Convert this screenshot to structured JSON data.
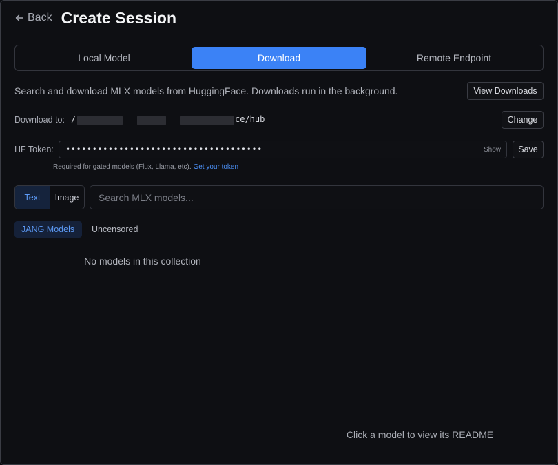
{
  "header": {
    "back_label": "Back",
    "title": "Create Session"
  },
  "mode_tabs": [
    {
      "label": "Local Model",
      "active": false
    },
    {
      "label": "Download",
      "active": true
    },
    {
      "label": "Remote Endpoint",
      "active": false
    }
  ],
  "description": "Search and download MLX models from HuggingFace. Downloads run in the background.",
  "view_downloads_label": "View Downloads",
  "download_to": {
    "label": "Download to:",
    "path_start": "/",
    "path_end": "ce/hub",
    "change_label": "Change"
  },
  "hf_token": {
    "label": "HF Token:",
    "masked_value": "•••••••••••••••••••••••••••••••••••••",
    "show_label": "Show",
    "save_label": "Save",
    "hint": "Required for gated models (Flux, Llama, etc).",
    "hint_link": "Get your token"
  },
  "type_toggle": [
    {
      "label": "Text",
      "active": true
    },
    {
      "label": "Image",
      "active": false
    }
  ],
  "search": {
    "placeholder": "Search MLX models...",
    "value": ""
  },
  "collections": [
    {
      "label": "JANG Models",
      "active": true
    },
    {
      "label": "Uncensored",
      "active": false
    }
  ],
  "empty_collection_text": "No models in this collection",
  "readme_placeholder": "Click a model to view its README",
  "colors": {
    "accent": "#3b82f6",
    "background": "#0e0f13",
    "border": "#33353d"
  }
}
